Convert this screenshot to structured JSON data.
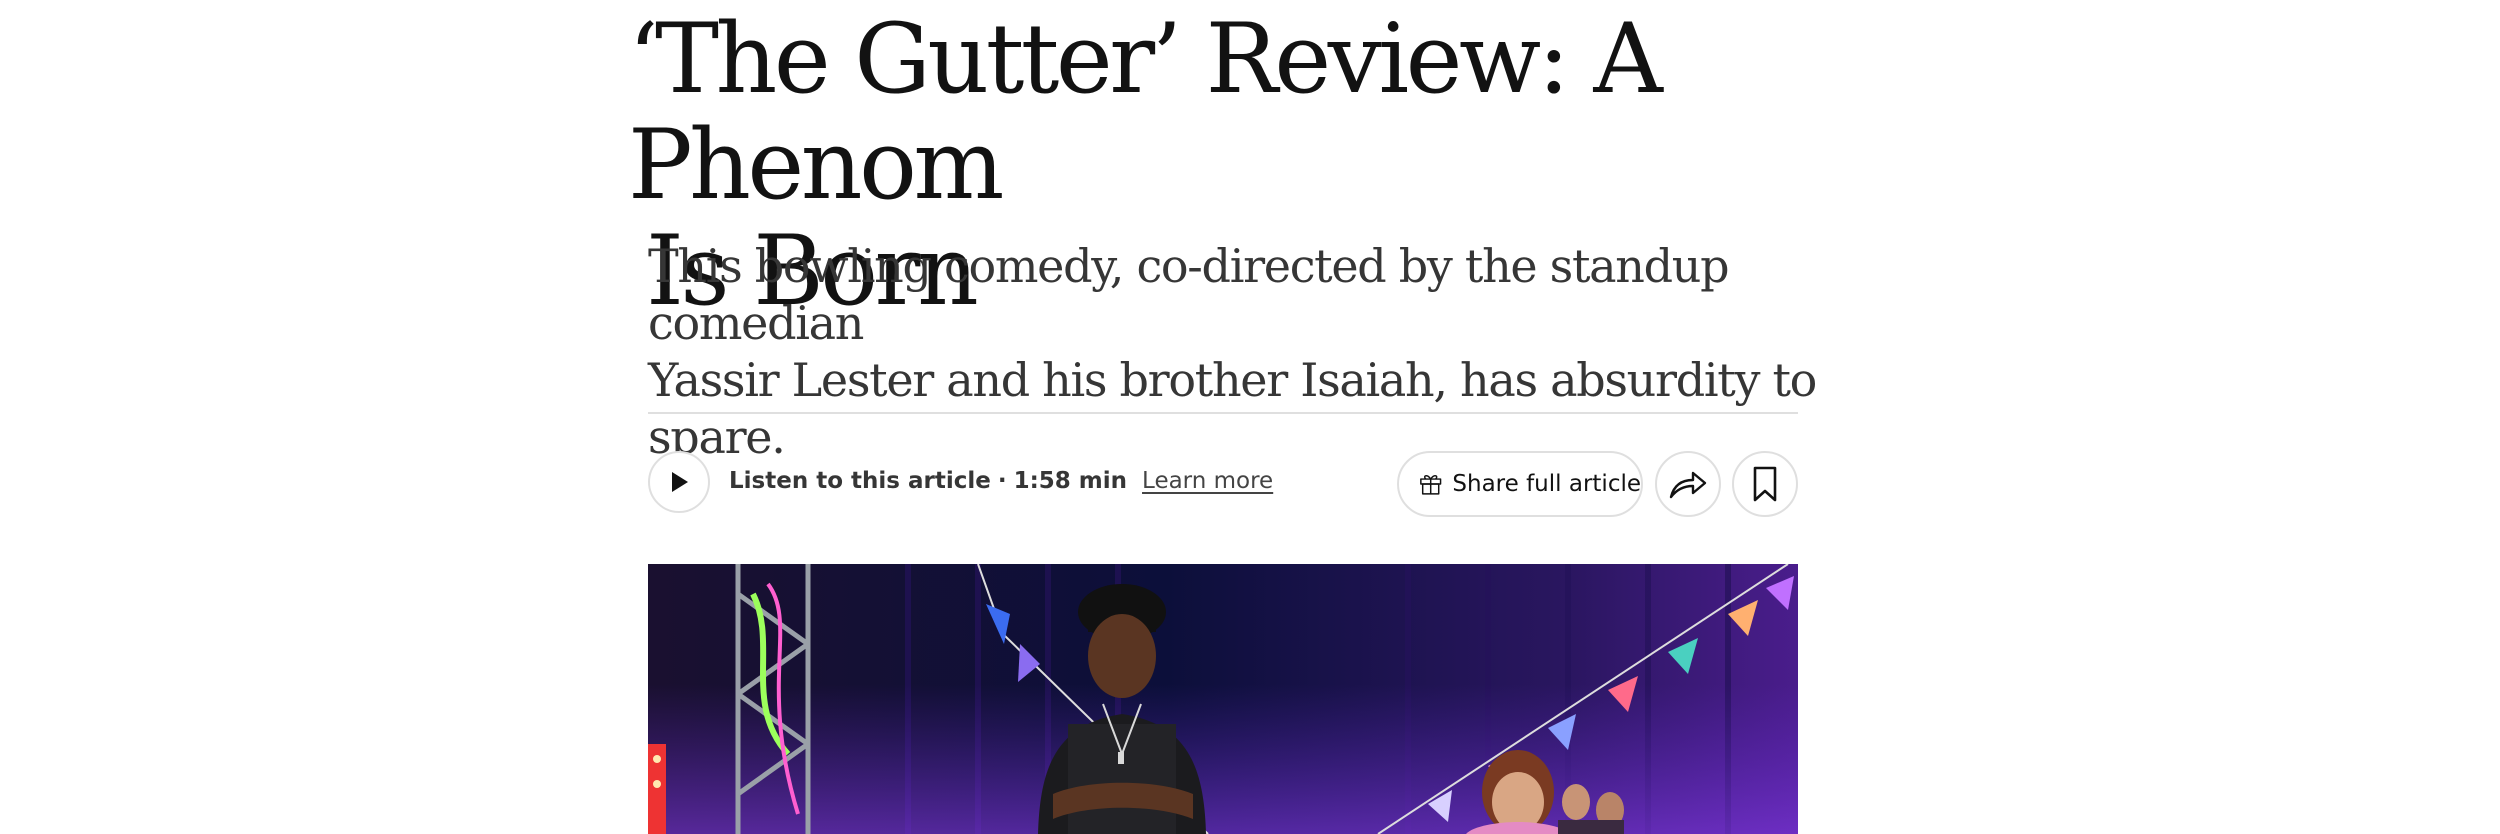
{
  "article": {
    "headline_line1": "‘The Gutter’ Review: A Phenom",
    "headline_line2": "Is Born",
    "summary_line1": "This bowling comedy, co-directed by the standup comedian",
    "summary_line2": "Yassir Lester and his brother Isaiah, has absurdity to spare."
  },
  "audio": {
    "play_icon": "play-icon",
    "label": "Listen to this article",
    "separator": "·",
    "duration": "1:58 min",
    "learn_more": "Learn more"
  },
  "actions": {
    "gift_icon": "gift-icon",
    "share_full_label": "Share full article",
    "share_icon": "share-arrow-icon",
    "save_icon": "bookmark-icon"
  },
  "colors": {
    "text": "#121212",
    "summary_text": "#363636",
    "divider": "#dfdfdf",
    "hero_backdrop": "#0c0f3a"
  }
}
